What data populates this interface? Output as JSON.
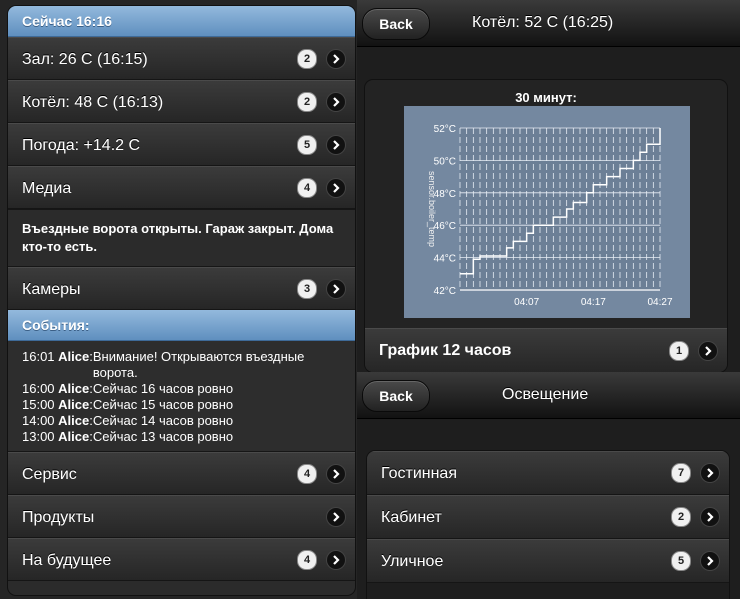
{
  "left": {
    "header": "Сейчас 16:16",
    "items_top": [
      {
        "label": "Зал: 26 C (16:15)",
        "count": "2"
      },
      {
        "label": "Котёл: 48 C (16:13)",
        "count": "2"
      },
      {
        "label": "Погода: +14.2 C",
        "count": "5"
      },
      {
        "label": "Медиа",
        "count": "4"
      }
    ],
    "status_text": "Въездные ворота открыты. Гараж закрыт. Дома кто-то есть.",
    "cameras": {
      "label": "Камеры",
      "count": "3"
    },
    "events_header": "События:",
    "events": [
      {
        "time": "16:01",
        "who": "Alice",
        "msg": "Внимание! Открываются въездные ворота."
      },
      {
        "time": "16:00",
        "who": "Alice",
        "msg": "Сейчас 16 часов ровно"
      },
      {
        "time": "15:00",
        "who": "Alice",
        "msg": "Сейчас 15 часов ровно"
      },
      {
        "time": "14:00",
        "who": "Alice",
        "msg": "Сейчас 14 часов ровно"
      },
      {
        "time": "13:00",
        "who": "Alice",
        "msg": "Сейчас 13 часов ровно"
      }
    ],
    "items_bottom": [
      {
        "label": "Сервис",
        "count": "4"
      },
      {
        "label": "Продукты",
        "count": ""
      },
      {
        "label": "На будущее",
        "count": "4"
      }
    ]
  },
  "right_top": {
    "back": "Back",
    "title": "Котёл: 52 C (16:25)",
    "chart_title": "30 минут:",
    "footer": {
      "label": "График 12 часов",
      "count": "1"
    }
  },
  "right_bottom": {
    "back": "Back",
    "title": "Освещение",
    "items": [
      {
        "label": "Гостинная",
        "count": "7"
      },
      {
        "label": "Кабинет",
        "count": "2"
      },
      {
        "label": "Уличное",
        "count": "5"
      }
    ]
  },
  "colors": {
    "accent": "#6f9cc9",
    "chart_bg": "#6c7f96"
  },
  "chart_data": {
    "type": "line",
    "ylabel": "sensor.boiler_temp",
    "y_ticks": [
      "52°C",
      "50°C",
      "48°C",
      "46°C",
      "44°C",
      "42°C"
    ],
    "x_ticks": [
      "04:07",
      "04:17",
      "04:27"
    ],
    "ylim": [
      42,
      52
    ],
    "x_minutes": [
      0,
      1,
      2,
      3,
      4,
      5,
      6,
      7,
      8,
      9,
      10,
      11,
      12,
      13,
      14,
      15,
      16,
      17,
      18,
      19,
      20,
      21,
      22,
      23,
      24,
      25,
      26,
      27,
      28,
      29,
      30
    ],
    "values": [
      43.0,
      43.0,
      43.9,
      44.1,
      44.1,
      44.1,
      44.1,
      44.6,
      45.0,
      45.0,
      45.5,
      46.0,
      46.0,
      46.0,
      46.5,
      46.5,
      47.0,
      47.4,
      47.4,
      48.0,
      48.5,
      48.5,
      49.0,
      49.0,
      49.5,
      49.5,
      50.0,
      50.5,
      51.0,
      51.0,
      52.0
    ]
  }
}
